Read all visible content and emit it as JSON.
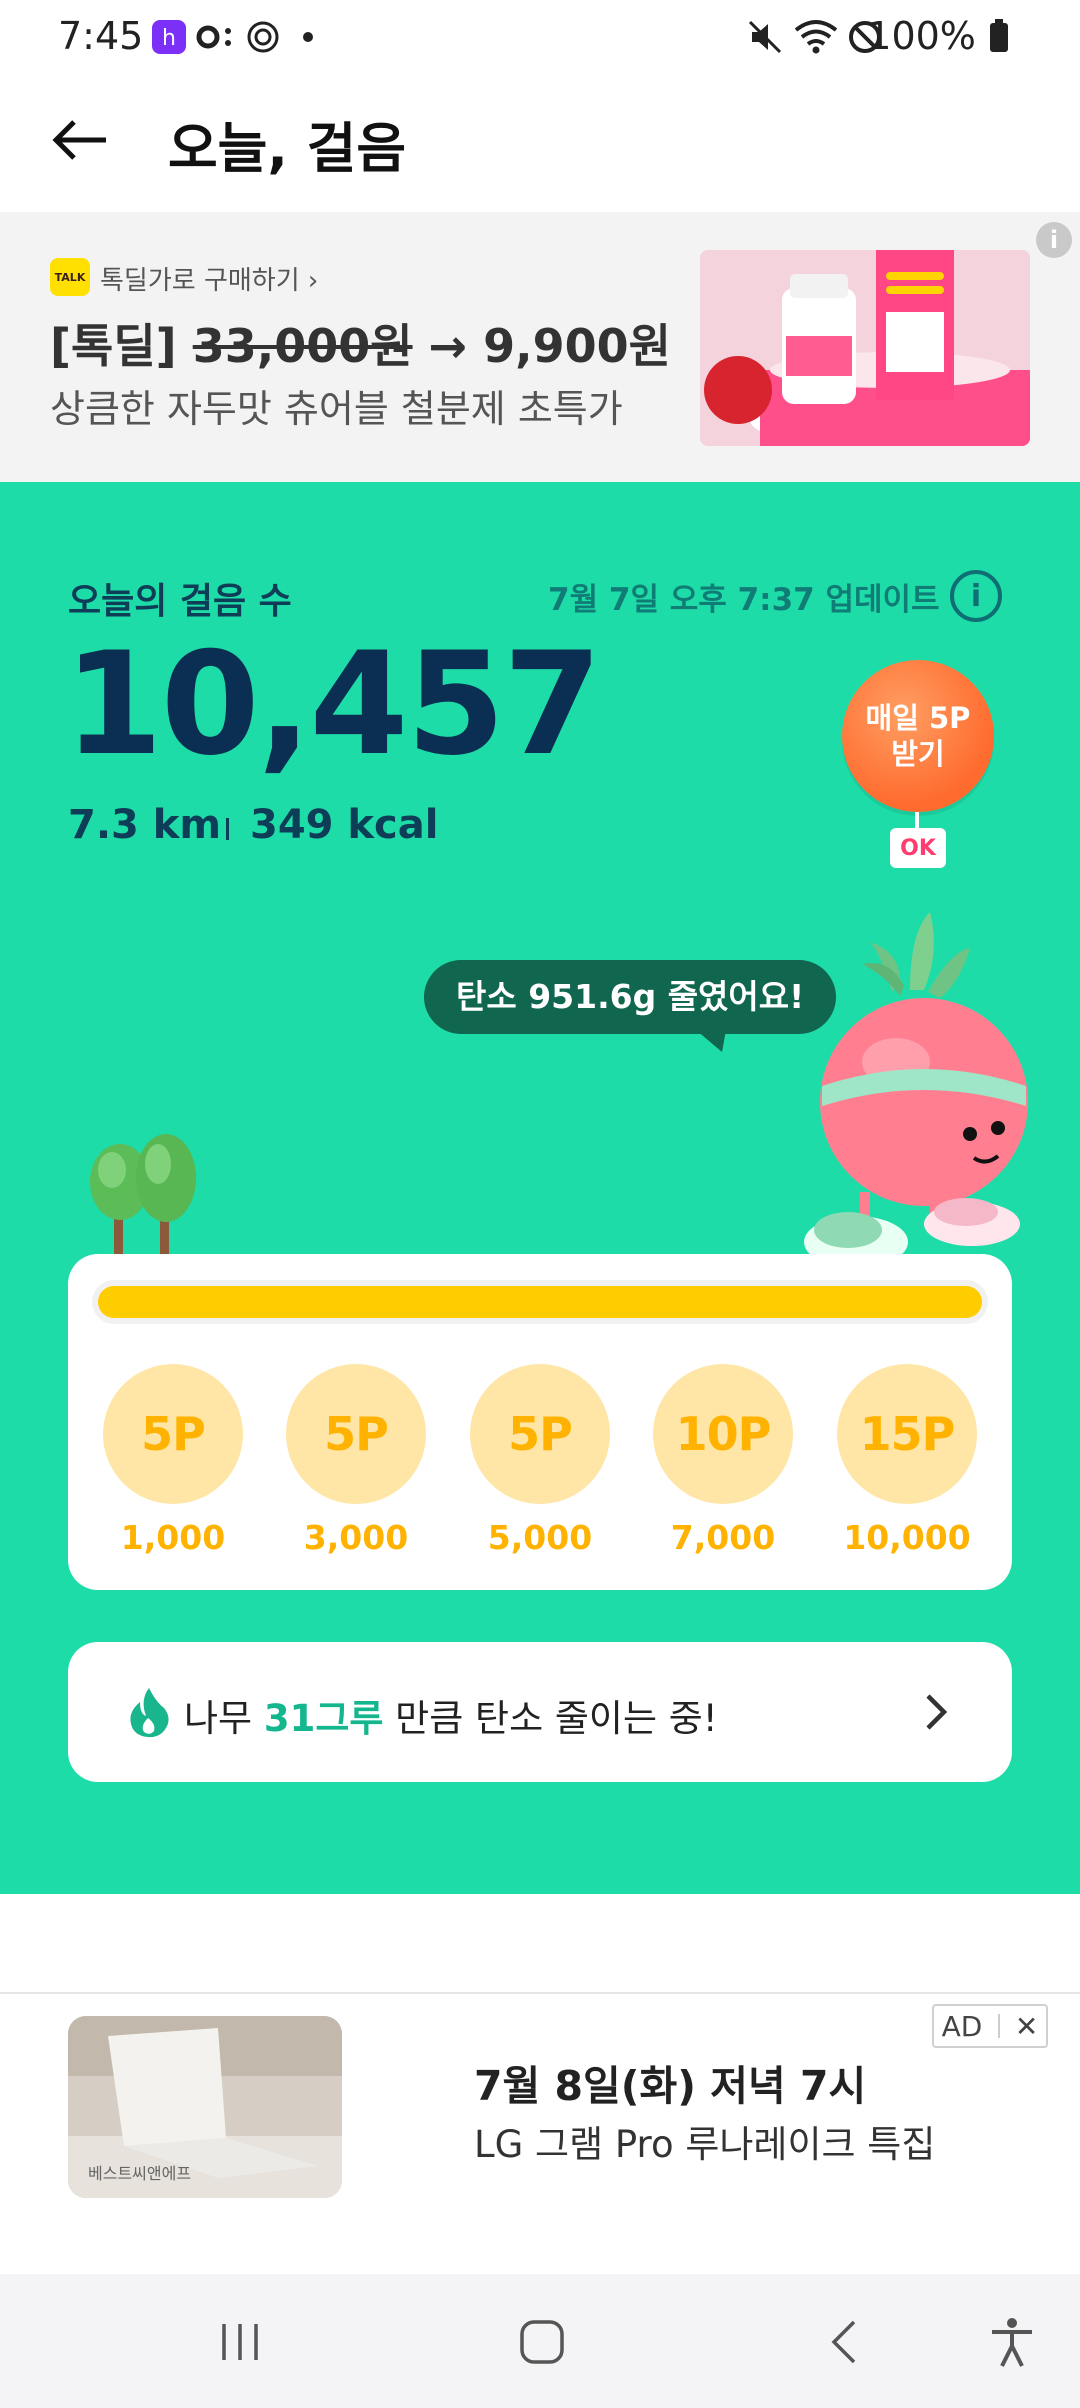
{
  "status_bar": {
    "time": "7:45",
    "battery": "100%"
  },
  "header": {
    "title": "오늘, 걸음"
  },
  "promo_banner": {
    "link_label": "톡딜가로 구매하기 ›",
    "talk_logo": "TALK",
    "title_prefix": "[톡딜] ",
    "original_price": "33,000원",
    "arrow_price": " → 9,900원",
    "subtitle": "상큼한 자두맛 츄어블 철분제 초특가",
    "info_icon": "i"
  },
  "walk": {
    "steps_label": "오늘의 걸음 수",
    "update_text": "7월 7일 오후 7:37 업데이트",
    "info_icon": "i",
    "step_count": "10,457",
    "distance": "7.3 km",
    "calories": "349 kcal",
    "balloon_line1": "매일 5P",
    "balloon_line2": "받기",
    "ok_badge": "OK",
    "carbon_message": "탄소 951.6g 줄였어요!",
    "progress_fraction": 1.0
  },
  "rewards": [
    {
      "points": "5P",
      "steps": "1,000"
    },
    {
      "points": "5P",
      "steps": "3,000"
    },
    {
      "points": "5P",
      "steps": "5,000"
    },
    {
      "points": "10P",
      "steps": "7,000"
    },
    {
      "points": "15P",
      "steps": "10,000"
    }
  ],
  "tree_pill": {
    "prefix": "나무 ",
    "highlight": "31그루",
    "suffix": " 만큼 탄소 줄이는 중!"
  },
  "bottom_ad": {
    "badge_label": "AD",
    "close_label": "✕",
    "title": "7월 8일(화) 저녁 7시",
    "subtitle": "LG 그램 Pro 루나레이크 특집",
    "thumb_label": "베스트씨앤에프"
  },
  "colors": {
    "green_bg": "#1edca8",
    "progress": "#ffcc00",
    "coin": "#ffe6a6"
  }
}
